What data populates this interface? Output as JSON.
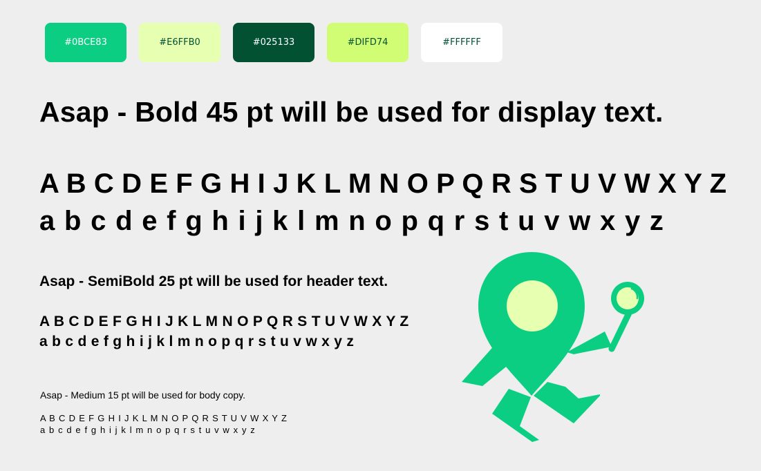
{
  "swatches": [
    {
      "label": "#0BCE83",
      "bg": "#0BCE83",
      "fg": "#FFFFFF"
    },
    {
      "label": "#E6FFB0",
      "bg": "#E6FFB0",
      "fg": "#025133"
    },
    {
      "label": "#025133",
      "bg": "#025133",
      "fg": "#FFFFFF"
    },
    {
      "label": "#DIFD74",
      "bg": "#D1FD74",
      "fg": "#025133"
    },
    {
      "label": "#FFFFFF",
      "bg": "#FFFFFF",
      "fg": "#025133"
    }
  ],
  "display": {
    "caption": "Asap - Bold  45 pt will be used for display text.",
    "uppercase": "A B C D E F G H I J K L M N O P Q R S T U V W X Y Z",
    "lowercase": "a b c d e f g h i j k l m n o p q r s t u v w x y z"
  },
  "header": {
    "caption": "Asap - SemiBold 25 pt will be used for header text.",
    "uppercase": "A B C D E F G H I J K L M N O P Q R S T U V W X Y Z",
    "lowercase": "a b c d e f g h i j k l m n o p q r s t u v w x y z"
  },
  "body": {
    "caption": "Asap - Medium 15 pt will be used for body copy.",
    "uppercase": "A B C D E F G H I J K L M N O P Q R S T U V W X Y Z",
    "lowercase": "a b c d e f g h i j k l m n o p q r s t u v w x y z"
  },
  "mascot": {
    "icon": "map-pin-mascot-with-magnifier-icon",
    "body_color": "#0BCE83",
    "face_color": "#E6FFB0"
  }
}
